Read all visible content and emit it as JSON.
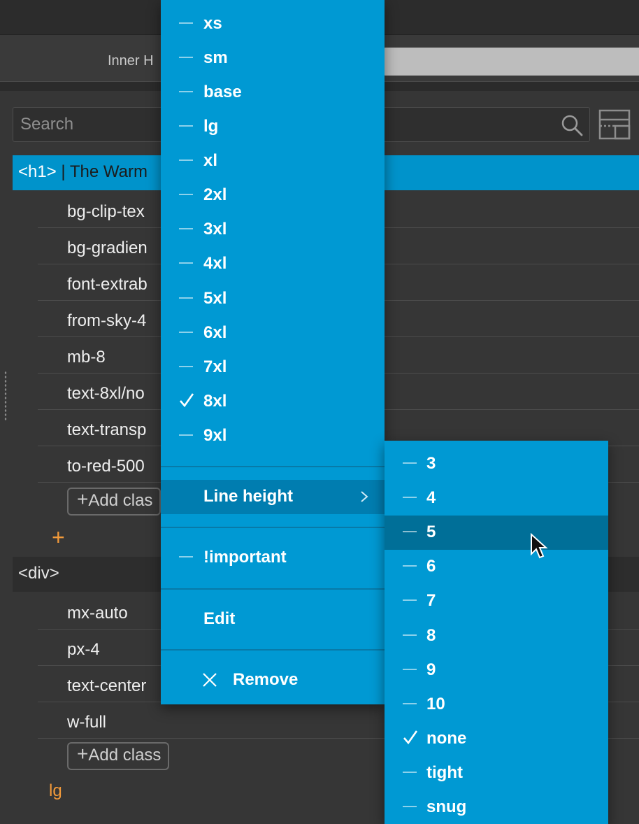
{
  "panel": {
    "inner_label": "Inner H",
    "search_placeholder": "Search",
    "h1_tag": "<h1>",
    "h1_text": " | The Warm",
    "h1_classes": [
      "bg-clip-tex",
      "bg-gradien",
      "font-extrab",
      "from-sky-4",
      "mb-8",
      "text-8xl/no",
      "text-transp",
      "to-red-500"
    ],
    "add_class_short": "Add clas",
    "div_tag": "<div>",
    "div_classes": [
      "mx-auto",
      "px-4",
      "text-center",
      "w-full"
    ],
    "add_class": "Add class",
    "plus": "+",
    "bottom_value": "lg"
  },
  "main_menu": {
    "sizes": [
      {
        "label": "xs",
        "checked": false
      },
      {
        "label": "sm",
        "checked": false
      },
      {
        "label": "base",
        "checked": false
      },
      {
        "label": "lg",
        "checked": false
      },
      {
        "label": "xl",
        "checked": false
      },
      {
        "label": "2xl",
        "checked": false
      },
      {
        "label": "3xl",
        "checked": false
      },
      {
        "label": "4xl",
        "checked": false
      },
      {
        "label": "5xl",
        "checked": false
      },
      {
        "label": "6xl",
        "checked": false
      },
      {
        "label": "7xl",
        "checked": false
      },
      {
        "label": "8xl",
        "checked": true
      },
      {
        "label": "9xl",
        "checked": false
      }
    ],
    "line_height": "Line height",
    "important": "!important",
    "edit": "Edit",
    "remove": "Remove"
  },
  "line_height_menu": {
    "items": [
      {
        "label": "3",
        "checked": false
      },
      {
        "label": "4",
        "checked": false
      },
      {
        "label": "5",
        "checked": false,
        "hovered": true
      },
      {
        "label": "6",
        "checked": false
      },
      {
        "label": "7",
        "checked": false
      },
      {
        "label": "8",
        "checked": false
      },
      {
        "label": "9",
        "checked": false
      },
      {
        "label": "10",
        "checked": false
      },
      {
        "label": "none",
        "checked": true
      },
      {
        "label": "tight",
        "checked": false
      },
      {
        "label": "snug",
        "checked": false
      }
    ]
  },
  "colors": {
    "menu_bg": "#0099d3",
    "hover_bg": "#006f98",
    "selected_header": "#0093cb",
    "accent_orange": "#f29a3a"
  }
}
